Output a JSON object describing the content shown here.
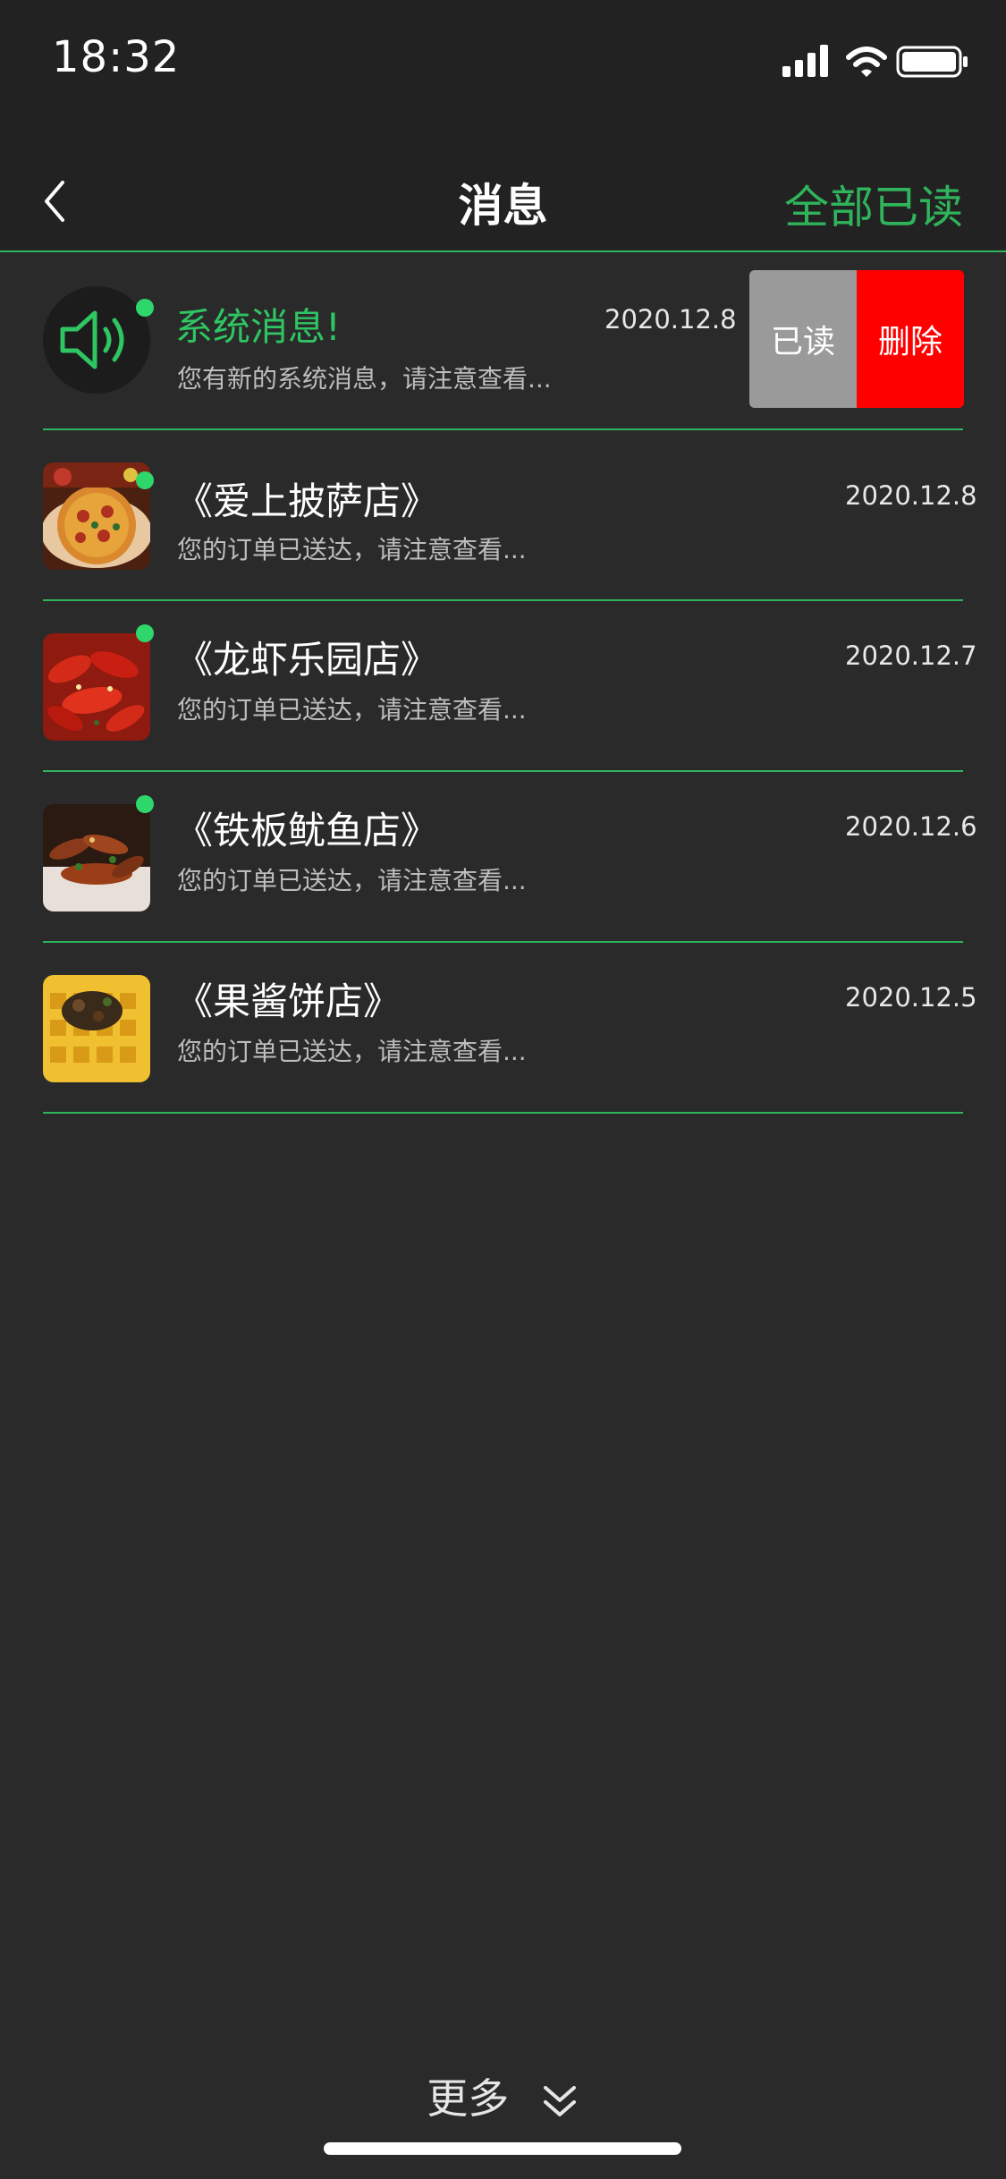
{
  "status_bar": {
    "time": "18:32"
  },
  "nav": {
    "title": "消息",
    "mark_all_read": "全部已读"
  },
  "messages": [
    {
      "title": "系统消息!",
      "subtitle": "您有新的系统消息，请注意查看...",
      "date": "2020.12.8",
      "unread": true,
      "icon": "speaker-icon"
    },
    {
      "title": "《爱上披萨店》",
      "subtitle": "您的订单已送达，请注意查看...",
      "date": "2020.12.8",
      "unread": true,
      "icon": "pizza-thumbnail"
    },
    {
      "title": "《龙虾乐园店》",
      "subtitle": "您的订单已送达，请注意查看...",
      "date": "2020.12.7",
      "unread": true,
      "icon": "crayfish-thumbnail"
    },
    {
      "title": "《铁板鱿鱼店》",
      "subtitle": "您的订单已送达，请注意查看...",
      "date": "2020.12.6",
      "unread": true,
      "icon": "squid-thumbnail"
    },
    {
      "title": "《果酱饼店》",
      "subtitle": "您的订单已送达，请注意查看...",
      "date": "2020.12.5",
      "unread": false,
      "icon": "waffle-thumbnail"
    }
  ],
  "swipe_actions": {
    "read_label": "已读",
    "delete_label": "删除"
  },
  "footer": {
    "more_label": "更多"
  },
  "colors": {
    "accent_green": "#2fb45b",
    "delete_red": "#ff0000",
    "read_gray": "#9a9a9a",
    "background": "#2a2a2a"
  }
}
